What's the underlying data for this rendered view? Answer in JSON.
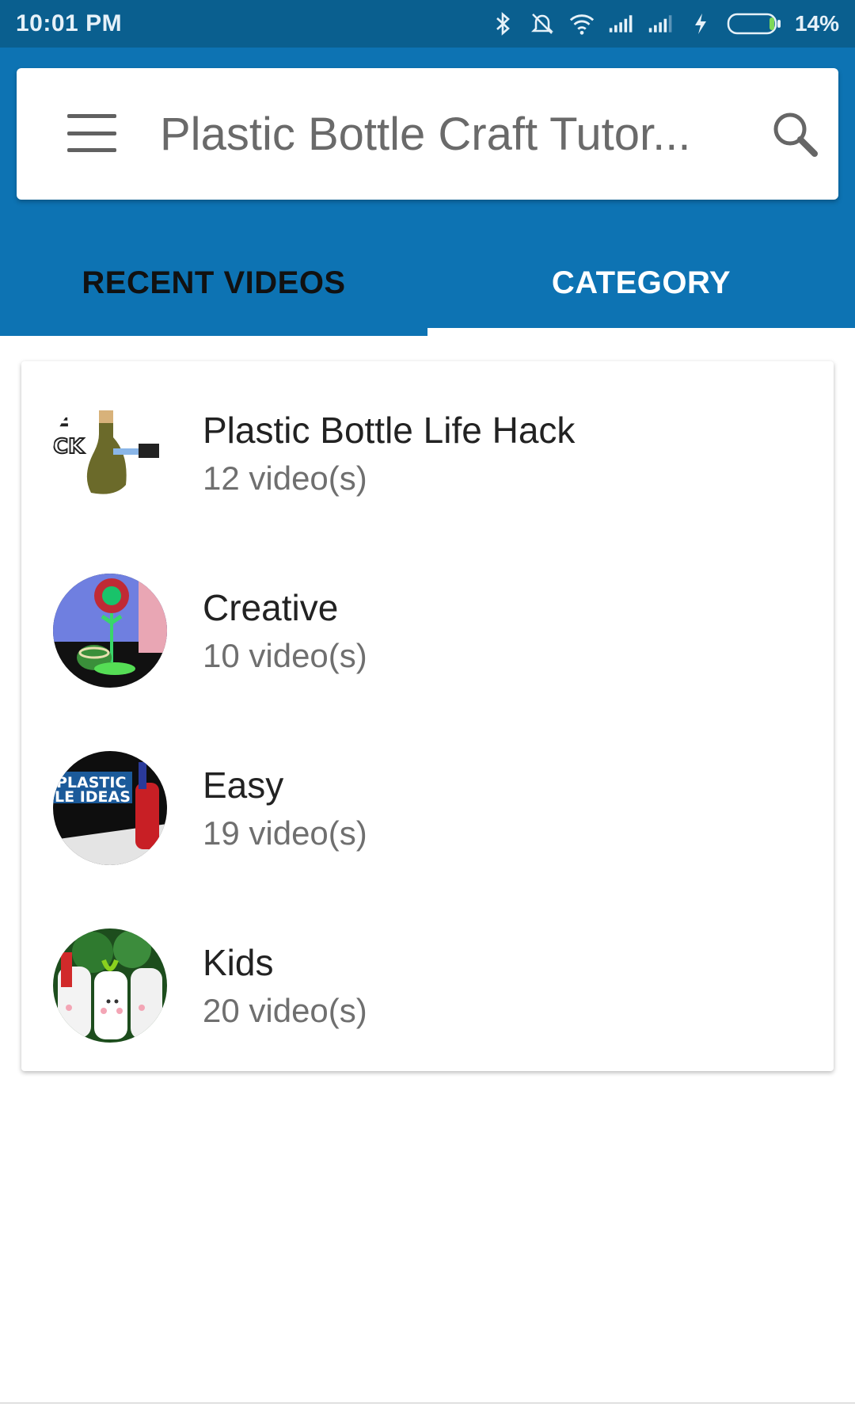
{
  "status_bar": {
    "time": "10:01 PM",
    "battery_percent": "14%",
    "icons": [
      "bluetooth-icon",
      "silent-icon",
      "wifi-icon",
      "signal-icon",
      "signal-icon",
      "charging-icon",
      "battery-icon"
    ]
  },
  "app_bar": {
    "title": "Plastic Bottle Craft Tutor...",
    "menu_icon": "menu-icon",
    "search_icon": "search-icon"
  },
  "tabs": [
    {
      "label": "RECENT VIDEOS",
      "selected": false
    },
    {
      "label": "CATEGORY",
      "selected": true
    }
  ],
  "categories": [
    {
      "title": "Plastic Bottle Life Hack",
      "count": "12 video(s)",
      "thumb_text": [
        "E",
        "CK"
      ]
    },
    {
      "title": "Creative",
      "count": "10 video(s)"
    },
    {
      "title": "Easy",
      "count": "19 video(s)",
      "thumb_text": [
        "PLASTIC",
        "LE IDEAS"
      ]
    },
    {
      "title": "Kids",
      "count": "20 video(s)"
    }
  ],
  "colors": {
    "status_bar": "#0a5f8f",
    "app_bar": "#0d73b3",
    "tab_indicator": "#ffffff"
  }
}
